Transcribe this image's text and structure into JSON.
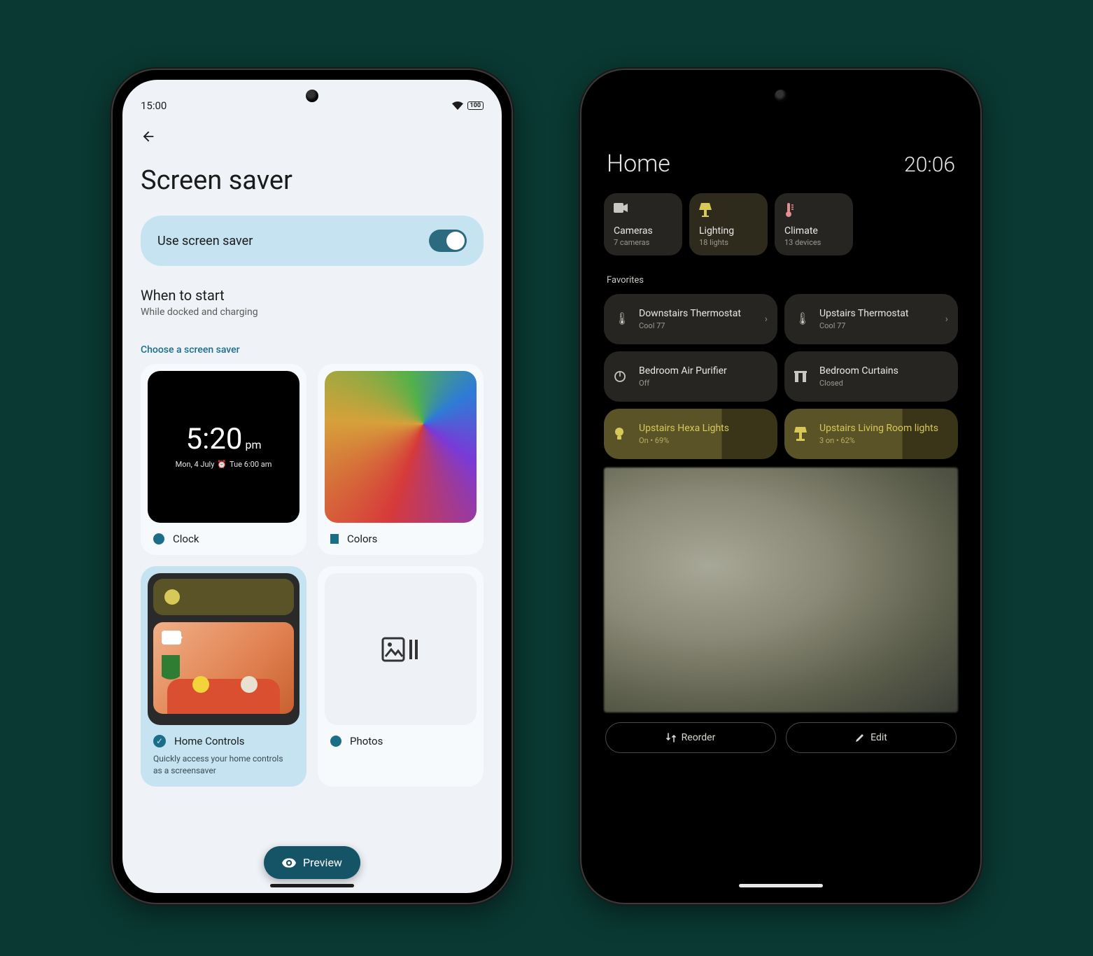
{
  "left": {
    "status": {
      "time": "15:00",
      "battery": "100"
    },
    "title": "Screen saver",
    "toggle_label": "Use screen saver",
    "when": {
      "heading": "When to start",
      "sub": "While docked and charging"
    },
    "choose_label": "Choose a screen saver",
    "clock": {
      "time": "5:20",
      "ampm": "pm",
      "sub_left": "Mon, 4 July",
      "sub_right": "Tue 6:00 am",
      "label": "Clock"
    },
    "colors": {
      "label": "Colors"
    },
    "home": {
      "label": "Home Controls",
      "desc": "Quickly access your home controls as a screensaver"
    },
    "photos": {
      "label": "Photos"
    },
    "preview": "Preview"
  },
  "right": {
    "title": "Home",
    "clock": "20:06",
    "categories": [
      {
        "name": "Cameras",
        "count": "7 cameras"
      },
      {
        "name": "Lighting",
        "count": "18 lights"
      },
      {
        "name": "Climate",
        "count": "13 devices"
      }
    ],
    "favorites_label": "Favorites",
    "tiles": [
      {
        "name": "Downstairs Thermostat",
        "status": "Cool 77"
      },
      {
        "name": "Upstairs Thermostat",
        "status": "Cool 77"
      },
      {
        "name": "Bedroom Air Purifier",
        "status": "Off"
      },
      {
        "name": "Bedroom Curtains",
        "status": "Closed"
      },
      {
        "name": "Upstairs Hexa Lights",
        "status": "On • 69%"
      },
      {
        "name": "Upstairs Living Room lights",
        "status": "3 on • 62%"
      }
    ],
    "reorder": "Reorder",
    "edit": "Edit"
  }
}
